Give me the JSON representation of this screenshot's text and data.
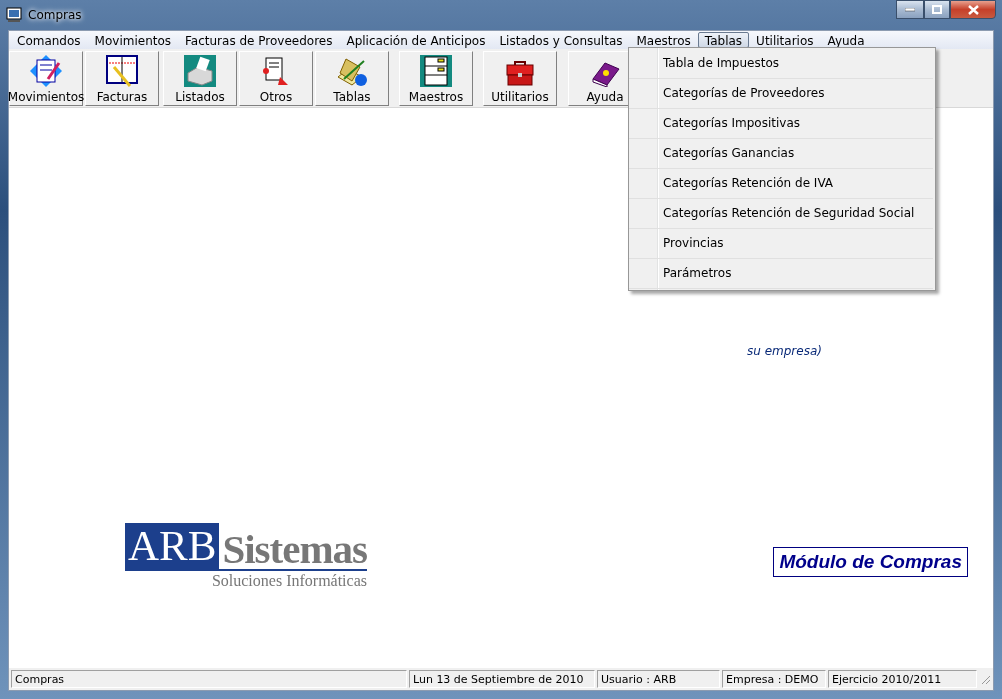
{
  "window": {
    "title": "Compras"
  },
  "menu_bar": [
    {
      "label": "Comandos",
      "selected": false
    },
    {
      "label": "Movimientos",
      "selected": false
    },
    {
      "label": "Facturas de Proveedores",
      "selected": false
    },
    {
      "label": "Aplicación de Anticipos",
      "selected": false
    },
    {
      "label": "Listados y Consultas",
      "selected": false
    },
    {
      "label": "Maestros",
      "selected": false
    },
    {
      "label": "Tablas",
      "selected": true
    },
    {
      "label": "Utilitarios",
      "selected": false
    },
    {
      "label": "Ayuda",
      "selected": false
    }
  ],
  "toolbar": [
    {
      "label": "Movimientos",
      "kind": "journal"
    },
    {
      "label": "Facturas",
      "kind": "invoice"
    },
    {
      "label": "Listados",
      "kind": "printer"
    },
    {
      "label": "Otros",
      "kind": "notes"
    },
    {
      "label": "Tablas",
      "kind": "ledger"
    },
    {
      "label": "Maestros",
      "kind": "cabinet"
    },
    {
      "label": "Utilitarios",
      "kind": "toolbox"
    },
    {
      "label": "Ayuda",
      "kind": "help"
    }
  ],
  "dropdown": [
    "Tabla de Impuestos",
    "Categorías de Proveedores",
    "Categorías Impositivas",
    "Categorías Ganancias",
    "Categorías Retención de IVA",
    "Categorías Retención de Seguridad Social",
    "Provincias",
    "Parámetros"
  ],
  "background_text": "su empresa)",
  "logo": {
    "brand_left": "ARB",
    "brand_right": "Sistemas",
    "tagline": "Soluciones Informáticas"
  },
  "module_label": "Módulo de Compras",
  "status_bar": [
    "Compras",
    "Lun 13 de Septiembre de 2010",
    "Usuario : ARB",
    "Empresa : DEMO",
    "Ejercicio 2010/2011"
  ]
}
